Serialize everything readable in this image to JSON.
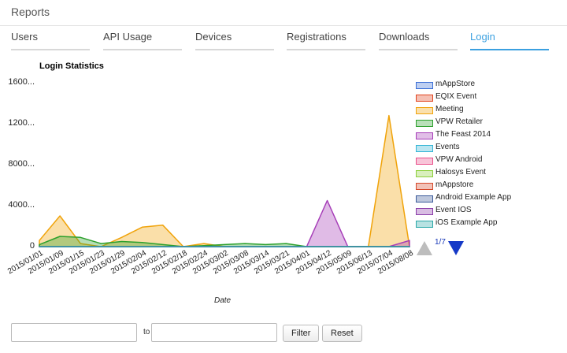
{
  "header": {
    "title": "Reports"
  },
  "tabs": [
    {
      "label": "Users",
      "active": false
    },
    {
      "label": "API Usage",
      "active": false
    },
    {
      "label": "Devices",
      "active": false
    },
    {
      "label": "Registrations",
      "active": false
    },
    {
      "label": "Downloads",
      "active": false
    },
    {
      "label": "Login",
      "active": true
    }
  ],
  "chart_data": {
    "type": "area",
    "title": "Login Statistics",
    "xlabel": "Date",
    "ylabel": "",
    "ylim": [
      0,
      16000
    ],
    "y_ticks": [
      0,
      4000,
      8000,
      12000,
      16000
    ],
    "y_tick_labels": [
      "0",
      "4000...",
      "8000...",
      "1200...",
      "1600..."
    ],
    "x": [
      "2015/01/01",
      "2015/01/09",
      "2015/01/15",
      "2015/01/23",
      "2015/01/29",
      "2015/02/04",
      "2015/02/12",
      "2015/02/18",
      "2015/02/24",
      "2015/03/02",
      "2015/03/08",
      "2015/03/14",
      "2015/03/21",
      "2015/04/01",
      "2015/04/12",
      "2015/05/09",
      "2015/06/13",
      "2015/07/04",
      "2015/08/08"
    ],
    "x_tick_labels": [
      "2015/01/01",
      "2015/01/09",
      "2015/01/15",
      "2015/01/23",
      "2015/01/29",
      "2015/02/04",
      "2015/02/12",
      "2015/02/18",
      "2015/02/24",
      "2015/03/02",
      "2015/03/08",
      "2015/03/14",
      "2015/03/21",
      "2015/04/01",
      "2015/04/12",
      "2015/05/09",
      "2015/06/13",
      "2015/07/04",
      "2015/08/08"
    ],
    "series": [
      {
        "name": "mAppStore",
        "color": "#3b6fd6",
        "values": [
          0,
          0,
          0,
          0,
          0,
          0,
          0,
          0,
          0,
          0,
          0,
          0,
          0,
          0,
          0,
          0,
          0,
          0,
          0
        ]
      },
      {
        "name": "EQIX Event",
        "color": "#e2431e",
        "values": [
          0,
          0,
          0,
          0,
          0,
          0,
          0,
          0,
          0,
          0,
          0,
          0,
          0,
          0,
          0,
          0,
          0,
          0,
          0
        ]
      },
      {
        "name": "Meeting",
        "color": "#f0a30a",
        "values": [
          600,
          3000,
          300,
          0,
          900,
          1900,
          2100,
          0,
          300,
          0,
          0,
          0,
          0,
          0,
          0,
          0,
          0,
          12800,
          0
        ]
      },
      {
        "name": "VPW Retailer",
        "color": "#2ca02c",
        "values": [
          200,
          1000,
          900,
          300,
          500,
          400,
          200,
          0,
          100,
          200,
          300,
          200,
          300,
          0,
          0,
          0,
          0,
          0,
          0
        ]
      },
      {
        "name": "The Feast 2014",
        "color": "#a63db8",
        "values": [
          0,
          0,
          0,
          0,
          0,
          0,
          0,
          0,
          0,
          0,
          0,
          0,
          0,
          0,
          4500,
          0,
          0,
          0,
          600
        ]
      },
      {
        "name": "Events",
        "color": "#33b5d6",
        "values": [
          0,
          0,
          0,
          0,
          0,
          0,
          0,
          0,
          0,
          0,
          0,
          0,
          0,
          0,
          0,
          0,
          0,
          0,
          0
        ]
      },
      {
        "name": "VPW Android",
        "color": "#e94e8a",
        "values": [
          0,
          0,
          0,
          0,
          0,
          0,
          0,
          0,
          0,
          0,
          0,
          0,
          0,
          0,
          0,
          0,
          0,
          0,
          0
        ]
      },
      {
        "name": "Halosys Event",
        "color": "#8ccf3a",
        "values": [
          0,
          0,
          0,
          0,
          0,
          0,
          0,
          0,
          0,
          0,
          0,
          0,
          0,
          0,
          0,
          0,
          0,
          0,
          0
        ]
      },
      {
        "name": "mAppstore",
        "color": "#d6492b",
        "values": [
          0,
          0,
          0,
          0,
          0,
          0,
          0,
          0,
          0,
          0,
          0,
          0,
          0,
          0,
          0,
          0,
          0,
          0,
          0
        ]
      },
      {
        "name": "Android Example App",
        "color": "#3b5b9a",
        "values": [
          0,
          0,
          0,
          0,
          0,
          0,
          0,
          0,
          0,
          0,
          0,
          0,
          0,
          0,
          0,
          0,
          0,
          0,
          0
        ]
      },
      {
        "name": "Event IOS",
        "color": "#8a3aa8",
        "values": [
          0,
          0,
          0,
          0,
          0,
          0,
          0,
          0,
          0,
          0,
          0,
          0,
          0,
          0,
          0,
          0,
          0,
          0,
          0
        ]
      },
      {
        "name": "iOS Example App",
        "color": "#2aa8a8",
        "values": [
          0,
          0,
          0,
          0,
          0,
          0,
          0,
          0,
          0,
          0,
          0,
          0,
          0,
          0,
          0,
          0,
          0,
          0,
          0
        ]
      }
    ],
    "legend": {
      "placement": "right"
    },
    "grid": false
  },
  "legend_pager": {
    "text": "1/7"
  },
  "filter": {
    "from_value": "",
    "to_label": "to",
    "to_value": "",
    "filter_label": "Filter",
    "reset_label": "Reset"
  }
}
